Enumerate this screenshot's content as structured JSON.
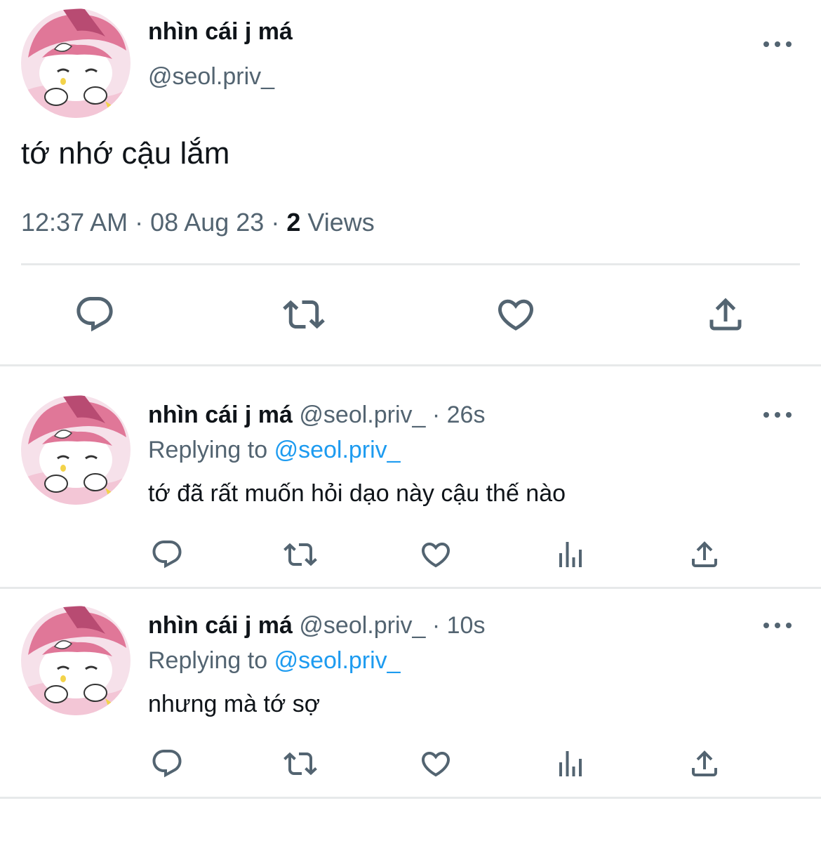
{
  "colors": {
    "text": "#0f1419",
    "secondary": "#536471",
    "link": "#1d9bf0",
    "divider": "#e7e9ea",
    "avatar_pink": "#e07798"
  },
  "main_tweet": {
    "display_name": "nhìn cái j má",
    "handle": "@seol.priv_",
    "text": "tớ nhớ cậu lắm",
    "time": "12:37 AM",
    "sep1": "·",
    "date": "08 Aug 23",
    "sep2": "·",
    "views_count": "2",
    "views_label": "Views",
    "actions": [
      "reply-icon",
      "retweet-icon",
      "like-icon",
      "share-icon"
    ]
  },
  "replies": [
    {
      "display_name": "nhìn cái j má",
      "handle_time": "@seol.priv_ · 26s",
      "replying_prefix": "Replying to",
      "replying_handle": "@seol.priv_",
      "text": "tớ đã rất muốn hỏi dạo này cậu thế nào",
      "actions": [
        "reply-icon",
        "retweet-icon",
        "like-icon",
        "views-icon",
        "share-icon"
      ]
    },
    {
      "display_name": "nhìn cái j má",
      "handle_time": "@seol.priv_ · 10s",
      "replying_prefix": "Replying to",
      "replying_handle": "@seol.priv_",
      "text": "nhưng mà tớ sợ",
      "actions": [
        "reply-icon",
        "retweet-icon",
        "like-icon",
        "views-icon",
        "share-icon"
      ]
    }
  ]
}
